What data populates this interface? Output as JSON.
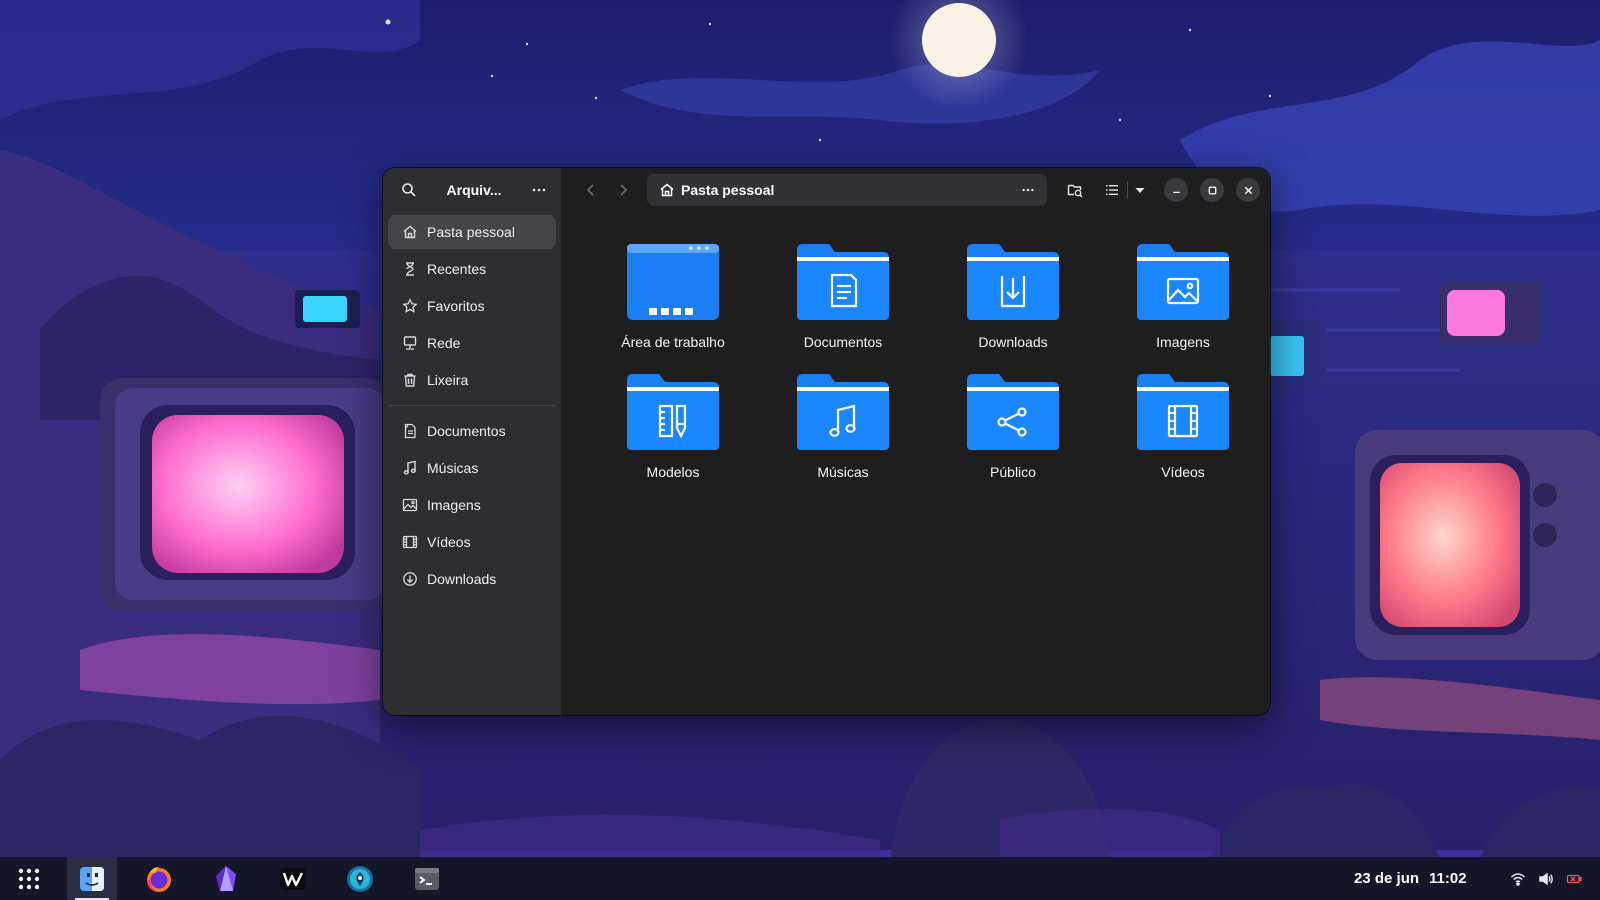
{
  "window": {
    "sidebar_title": "Arquiv...",
    "path_label": "Pasta pessoal"
  },
  "sidebar": {
    "places": [
      {
        "label": "Pasta pessoal",
        "icon": "home-icon",
        "active": true
      },
      {
        "label": "Recentes",
        "icon": "clock-icon",
        "active": false
      },
      {
        "label": "Favoritos",
        "icon": "star-icon",
        "active": false
      },
      {
        "label": "Rede",
        "icon": "network-icon",
        "active": false
      },
      {
        "label": "Lixeira",
        "icon": "trash-icon",
        "active": false
      }
    ],
    "bookmarks": [
      {
        "label": "Documentos",
        "icon": "document-icon"
      },
      {
        "label": "Músicas",
        "icon": "music-icon"
      },
      {
        "label": "Imagens",
        "icon": "image-icon"
      },
      {
        "label": "Vídeos",
        "icon": "video-icon"
      },
      {
        "label": "Downloads",
        "icon": "download-icon"
      }
    ]
  },
  "folders": [
    {
      "name": "Área de trabalho",
      "icon": "desktop-folder-icon"
    },
    {
      "name": "Documentos",
      "icon": "documents-folder-icon"
    },
    {
      "name": "Downloads",
      "icon": "downloads-folder-icon"
    },
    {
      "name": "Imagens",
      "icon": "pictures-folder-icon"
    },
    {
      "name": "Modelos",
      "icon": "templates-folder-icon"
    },
    {
      "name": "Músicas",
      "icon": "music-folder-icon"
    },
    {
      "name": "Público",
      "icon": "public-folder-icon"
    },
    {
      "name": "Vídeos",
      "icon": "videos-folder-icon"
    }
  ],
  "taskbar": {
    "apps": [
      "app-grid-icon",
      "files-icon",
      "firefox-icon",
      "obsidian-icon",
      "warp-icon",
      "terminal-app-icon",
      "console-icon"
    ],
    "date": "23 de jun",
    "time": "11:02"
  },
  "colors": {
    "folder_blue": "#1a7ef5",
    "folder_blue_light": "#58a6ff",
    "sidebar_bg": "#2e2e32",
    "window_bg": "#1e1e1e",
    "accent_pink": "#ff6fd0"
  }
}
